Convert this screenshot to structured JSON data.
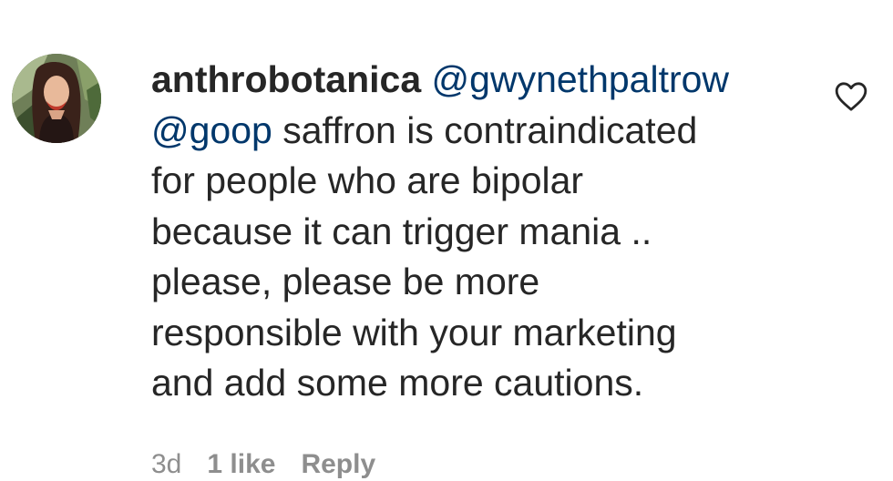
{
  "comment": {
    "username": "anthrobotanica",
    "mention_1": "@gwynethpaltrow",
    "mention_2": "@goop",
    "line_1_rest": " saffron is contraindicated",
    "line_2": "for people who are bipolar",
    "line_3": "because it can trigger mania ..",
    "line_4": "please, please be more",
    "line_5": "responsible with your marketing",
    "line_6": "and add some more cautions.",
    "avatar_icon": "profile-photo",
    "like_icon": "heart-outline-icon"
  },
  "meta": {
    "time": "3d",
    "likes": "1 like",
    "reply_label": "Reply"
  },
  "colors": {
    "text": "#262626",
    "mention": "#00376b",
    "muted": "#8e8e8e"
  }
}
